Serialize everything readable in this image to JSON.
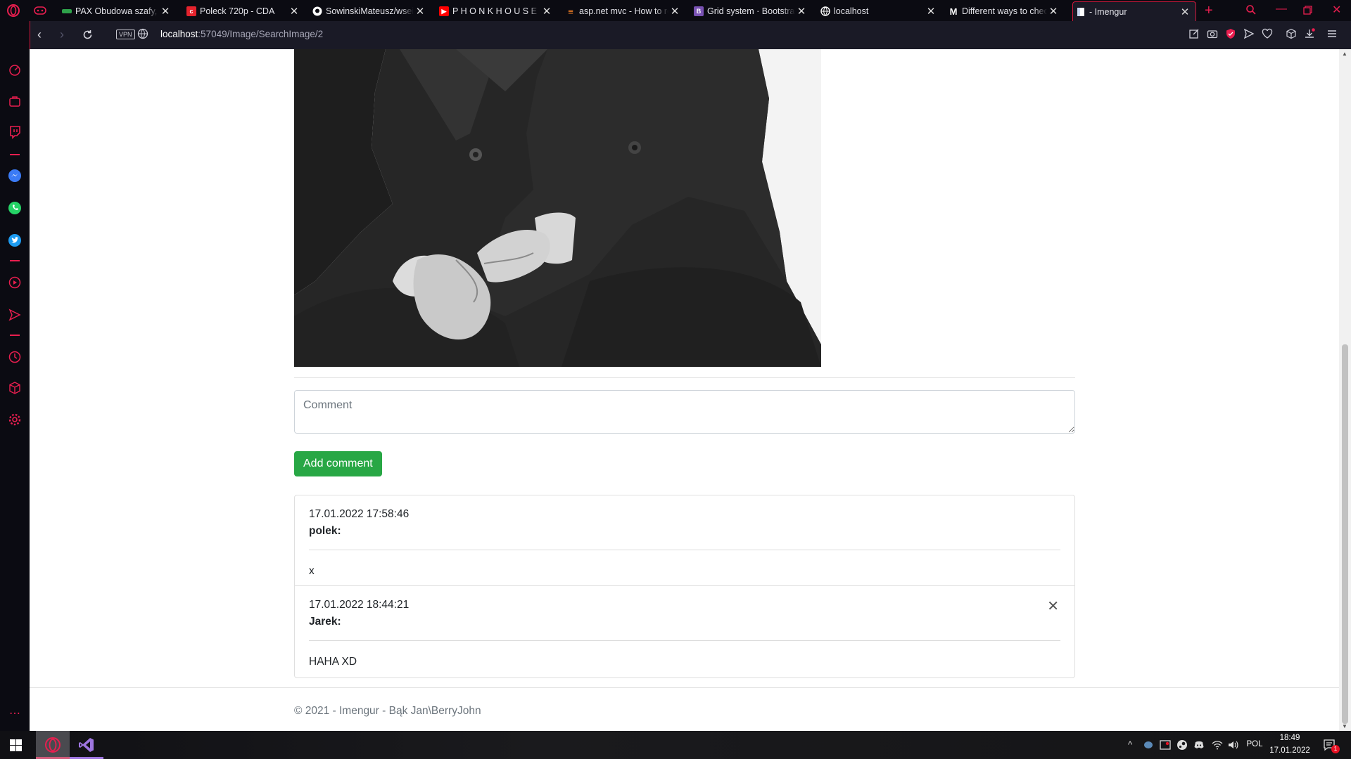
{
  "browser": {
    "tabs": [
      {
        "title": "PAX Obudowa szafy, czarny",
        "favicon": "ikea-favicon",
        "favicon_color": "#2ea24a"
      },
      {
        "title": "Poleck 720p - CDA",
        "favicon": "cda-favicon",
        "favicon_color": "#e5232d"
      },
      {
        "title": "SowinskiMateusz/wsei-project",
        "favicon": "github-favicon",
        "favicon_color": "#ffffff"
      },
      {
        "title": "P H O N K   H O U S E",
        "favicon": "youtube-favicon",
        "favicon_color": "#ff0000"
      },
      {
        "title": "asp.net mvc - How to render",
        "favicon": "stackoverflow-favicon",
        "favicon_color": "#f48024"
      },
      {
        "title": "Grid system · Bootstrap",
        "favicon": "bootstrap-favicon",
        "favicon_color": "#7952b3"
      },
      {
        "title": "localhost",
        "favicon": "globe-favicon",
        "favicon_color": "#ffffff"
      },
      {
        "title": "Different ways to check",
        "favicon": "medium-favicon",
        "favicon_color": "#ffffff"
      },
      {
        "title": "- Imengur",
        "favicon": "page-favicon",
        "favicon_color": "#ffffff"
      }
    ],
    "address": {
      "vpn_label": "VPN",
      "url_host": "localhost",
      "url_path": ":57049/Image/SearchImage/2"
    },
    "accent_color": "#e91e4f"
  },
  "page": {
    "comment_form": {
      "placeholder": "Comment",
      "submit_label": "Add comment"
    },
    "comments": [
      {
        "date": "17.01.2022 17:58:46",
        "author": "polek:",
        "text": "x",
        "deletable": false
      },
      {
        "date": "17.01.2022 18:44:21",
        "author": "Jarek:",
        "text": "HAHA XD",
        "deletable": true
      }
    ],
    "footer": "© 2021 - Imengur - Bąk Jan\\BerryJohn",
    "button_color": "#28a745"
  },
  "taskbar": {
    "language": "POL",
    "time": "18:49",
    "date": "17.01.2022",
    "notifications": "1"
  }
}
